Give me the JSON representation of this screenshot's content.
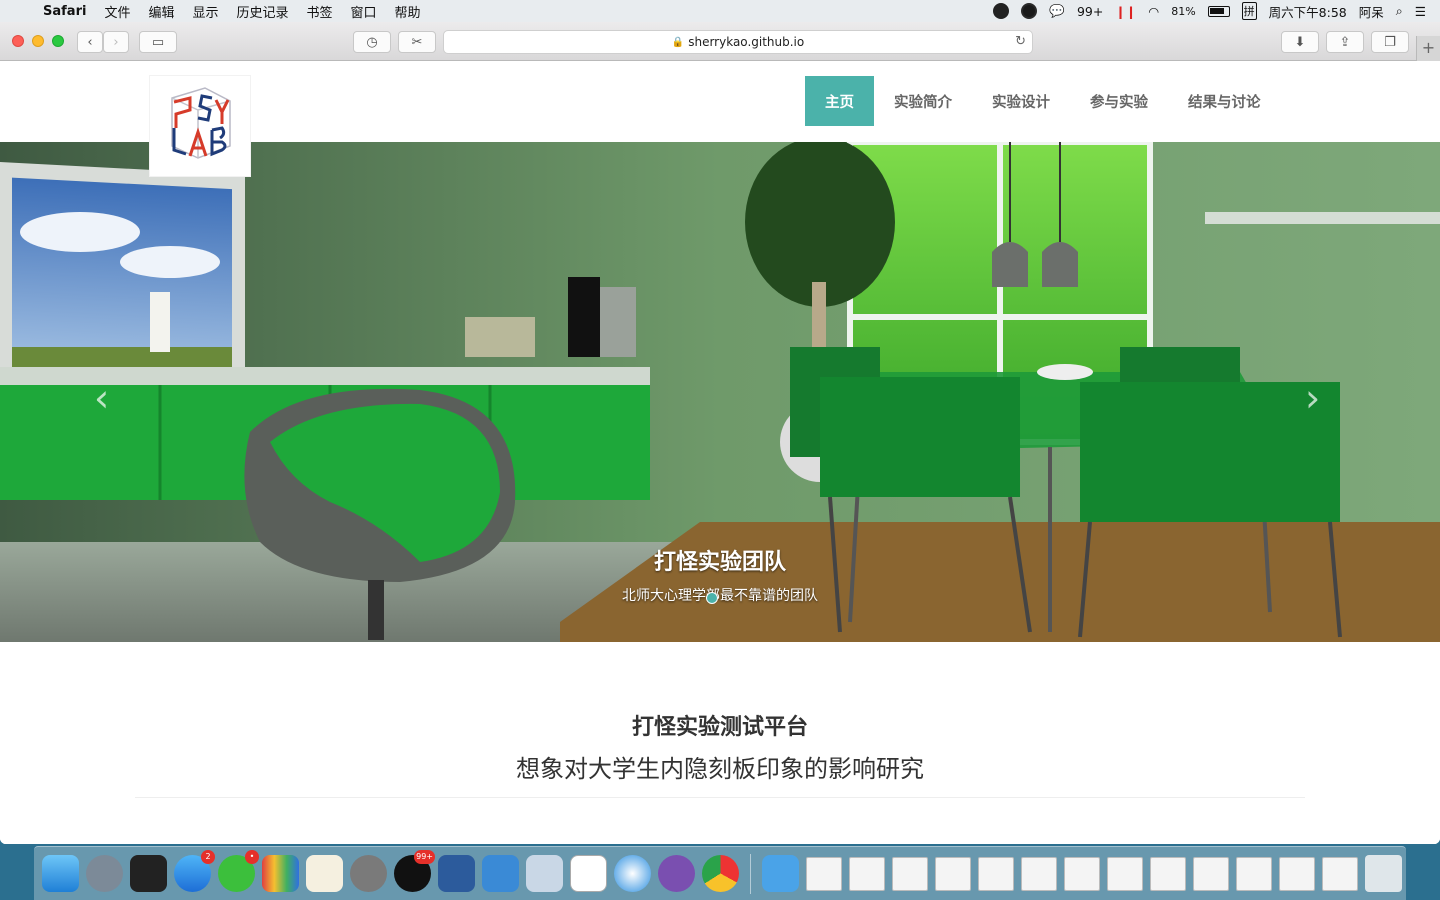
{
  "menubar": {
    "apple": "",
    "app_name": "Safari",
    "menus": [
      "文件",
      "编辑",
      "显示",
      "历史记录",
      "书签",
      "窗口",
      "帮助"
    ],
    "status": {
      "wechat_count": "99+",
      "battery": "81%",
      "input_method": "拼",
      "clock": "周六下午8:58",
      "user": "阿呆"
    }
  },
  "browser": {
    "url": "sherrykao.github.io",
    "new_tab": "+"
  },
  "site": {
    "logo_letters": "PSY LAB",
    "nav": [
      {
        "label": "主页",
        "active": true
      },
      {
        "label": "实验简介",
        "active": false
      },
      {
        "label": "实验设计",
        "active": false
      },
      {
        "label": "参与实验",
        "active": false
      },
      {
        "label": "结果与讨论",
        "active": false
      }
    ],
    "carousel": {
      "prev": "‹",
      "next": "›",
      "title": "打怪实验团队",
      "subtitle": "北师大心理学部最不靠谱的团队"
    },
    "intro": {
      "title": "打怪实验测试平台",
      "subtitle": "想象对大学生内隐刻板印象的影响研究"
    }
  },
  "dock": {
    "badges": {
      "appstore": "2",
      "wechat": "•",
      "qq": "99+"
    }
  },
  "colors": {
    "accent": "#4bb2aa",
    "nav_text": "#666666",
    "menubar_bg": "#e8ecef"
  }
}
